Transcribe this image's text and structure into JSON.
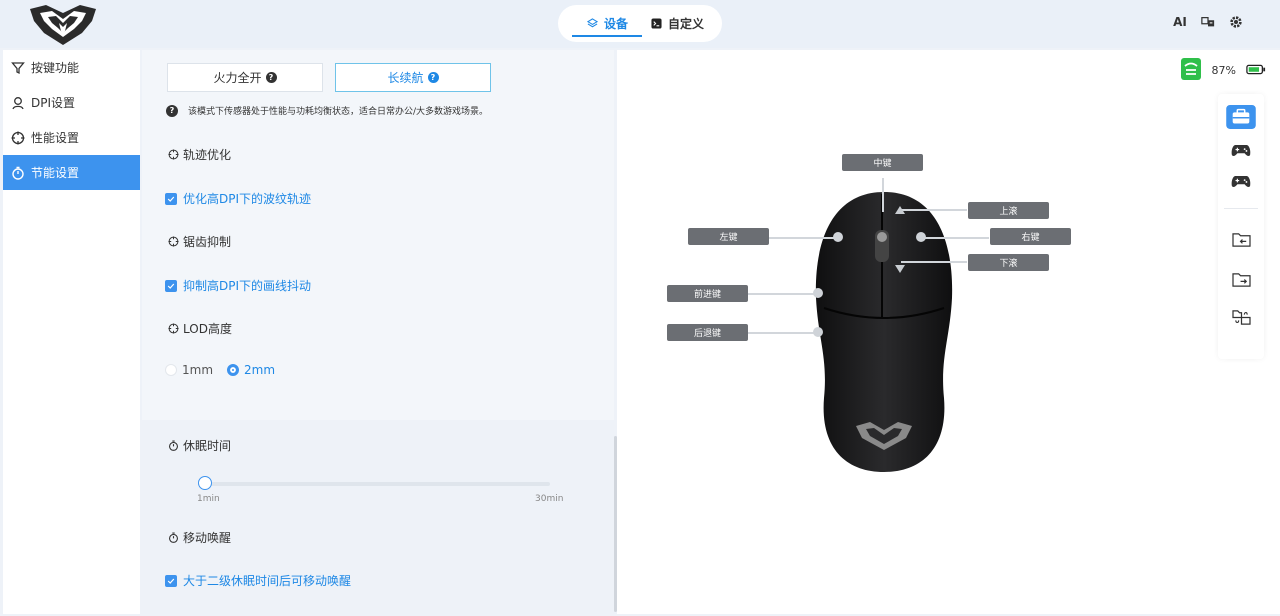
{
  "header": {
    "tabs": [
      {
        "label": "设备",
        "active": true
      },
      {
        "label": "自定义",
        "active": false
      }
    ],
    "right_icons": [
      "ai-icon",
      "translate-icon",
      "gear-icon"
    ],
    "ai_label": "AI"
  },
  "sidebar": {
    "items": [
      {
        "label": "按键功能",
        "icon": "filter-icon",
        "active": false
      },
      {
        "label": "DPI设置",
        "icon": "dpi-icon",
        "active": false
      },
      {
        "label": "性能设置",
        "icon": "crosshair-icon",
        "active": false
      },
      {
        "label": "节能设置",
        "icon": "stopwatch-icon",
        "active": true
      }
    ]
  },
  "power": {
    "modes": [
      {
        "label": "火力全开",
        "active": false
      },
      {
        "label": "长续航",
        "active": true
      }
    ],
    "mode_description": "该模式下传感器处于性能与功耗均衡状态，适合日常办公/大多数游戏场景。",
    "trajectory": {
      "title": "轨迹优化",
      "checkbox_label": "优化高DPI下的波纹轨迹",
      "checked": true
    },
    "jitter": {
      "title": "锯齿抑制",
      "checkbox_label": "抑制高DPI下的画线抖动",
      "checked": true
    },
    "lod": {
      "title": "LOD高度",
      "options": [
        "1mm",
        "2mm"
      ],
      "selected": "2mm"
    },
    "sleep": {
      "title": "休眠时间",
      "min_label": "1min",
      "max_label": "30min",
      "value_fraction": 0.0
    },
    "wake": {
      "title": "移动唤醒",
      "checkbox_label": "大于二级休眠时间后可移动唤醒",
      "checked": true
    }
  },
  "device": {
    "battery_percent": "87%",
    "battery_level": 0.87,
    "colors": {
      "accent": "#1e88e5",
      "battery": "#2fbf4a",
      "label_bg": "#6b6e73"
    },
    "buttons": {
      "middle": "中键",
      "scroll_up": "上滚",
      "left": "左键",
      "right": "右键",
      "scroll_down": "下滚",
      "forward": "前进键",
      "back": "后退键"
    },
    "tools": [
      "toolbox-icon",
      "gamepad-icon",
      "gamepad-alt-icon",
      "folder-import-icon",
      "folder-export-icon",
      "folder-sync-icon"
    ]
  }
}
